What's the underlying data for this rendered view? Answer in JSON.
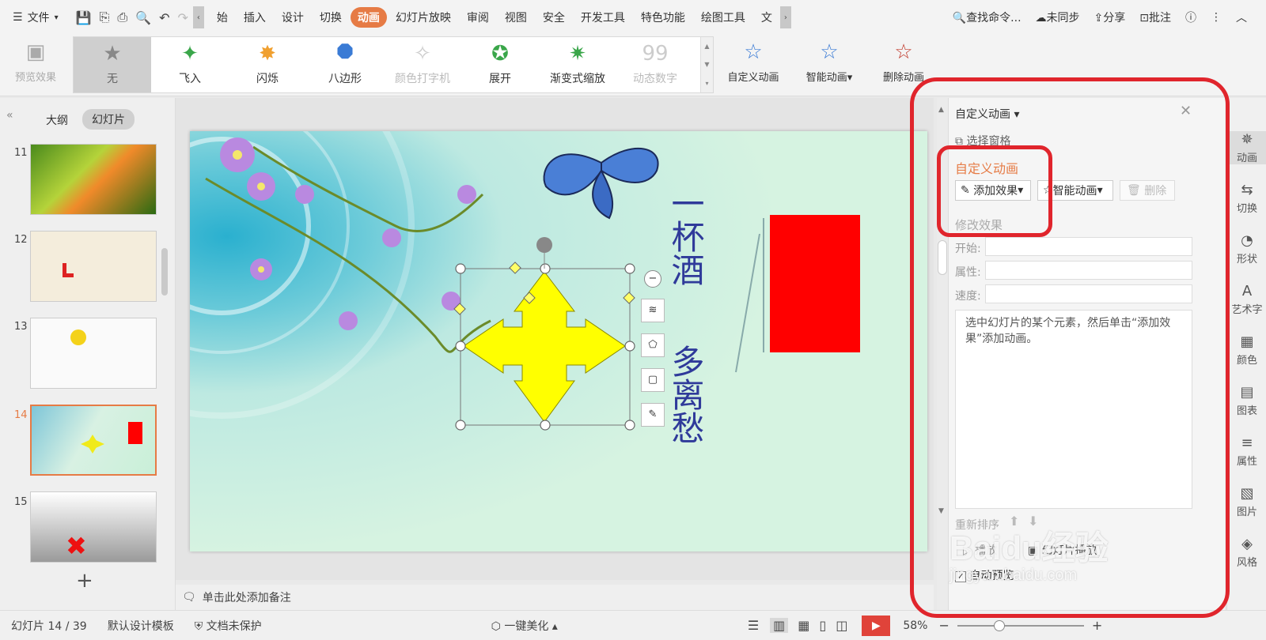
{
  "menubar": {
    "file_label": "文件",
    "tabs": [
      "始",
      "插入",
      "设计",
      "切换",
      "动画",
      "幻灯片放映",
      "审阅",
      "视图",
      "安全",
      "开发工具",
      "特色功能",
      "绘图工具",
      "文"
    ],
    "active_tab": "动画",
    "search_placeholder": "查找命令...",
    "sync_label": "未同步",
    "share_label": "分享",
    "annotate_label": "批注"
  },
  "ribbon": {
    "preview_label": "预览效果",
    "gallery": [
      {
        "label": "无",
        "state": "selected",
        "icon": "star-icon"
      },
      {
        "label": "飞入",
        "state": "normal",
        "icon": "fly-in-icon"
      },
      {
        "label": "闪烁",
        "state": "normal",
        "icon": "flash-icon"
      },
      {
        "label": "八边形",
        "state": "normal",
        "icon": "octagon-icon"
      },
      {
        "label": "颜色打字机",
        "state": "disabled",
        "icon": "typewriter-icon"
      },
      {
        "label": "展开",
        "state": "normal",
        "icon": "expand-icon"
      },
      {
        "label": "渐变式缩放",
        "state": "normal",
        "icon": "zoom-icon"
      },
      {
        "label": "动态数字",
        "state": "disabled",
        "icon": "dynamic-number-icon"
      }
    ],
    "custom_anim_label": "自定义动画",
    "smart_anim_label": "智能动画",
    "delete_anim_label": "删除动画"
  },
  "leftpanel": {
    "outline_tab": "大纲",
    "slides_tab": "幻灯片",
    "thumbnails": [
      "11",
      "12",
      "13",
      "14",
      "15"
    ],
    "selected": "14"
  },
  "slide": {
    "poem_line1": "一杯酒",
    "poem_line2": "多离愁"
  },
  "notes": {
    "placeholder": "单击此处添加备注"
  },
  "taskpane": {
    "header": "自定义动画",
    "select_pane": "选择窗格",
    "section_title": "自定义动画",
    "add_effect": "添加效果",
    "smart_anim": "智能动画",
    "delete": "删除",
    "modify_effect": "修改效果",
    "start_label": "开始:",
    "property_label": "属性:",
    "speed_label": "速度:",
    "hint": "选中幻灯片的某个元素，然后单击“添加效果”添加动画。",
    "reorder_label": "重新排序",
    "play_label": "播放",
    "slideshow_label": "幻灯片播放",
    "auto_preview": "自动预览"
  },
  "rightbar": [
    "动画",
    "切换",
    "形状",
    "艺术字",
    "颜色",
    "图表",
    "属性",
    "图片",
    "风格"
  ],
  "statusbar": {
    "slide_info": "幻灯片 14 / 39",
    "template": "默认设计模板",
    "protect": "文档未保护",
    "beautify": "一键美化",
    "zoom": "58%"
  },
  "watermark": {
    "brand": "Baidu经验",
    "url": "jingyan.baidu.com"
  },
  "colors": {
    "accent": "#e67b45",
    "highlight": "#e0252c"
  }
}
